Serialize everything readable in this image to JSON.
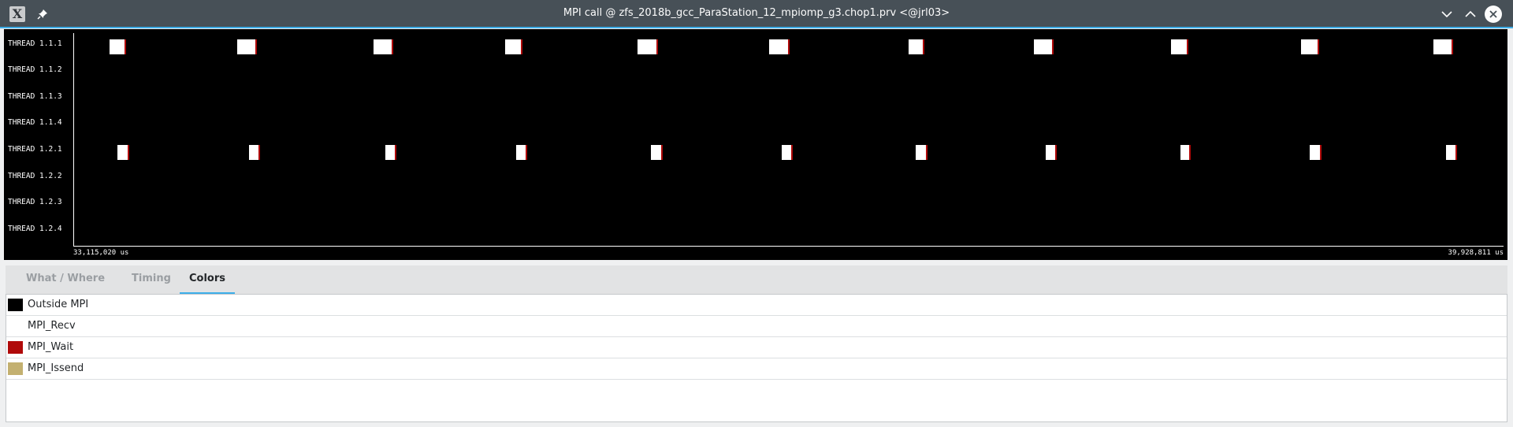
{
  "window": {
    "title": "MPI call @ zfs_2018b_gcc_ParaStation_12_mpiomp_g3.chop1.prv <@jrl03>",
    "app_icon": "X",
    "icons": {
      "app": "x-app-icon",
      "pin": "pin-icon",
      "minimize": "chevron-down-icon",
      "maximize": "chevron-up-icon",
      "close": "close-icon"
    }
  },
  "timeline": {
    "threads": [
      "THREAD 1.1.1",
      "THREAD 1.1.2",
      "THREAD 1.1.3",
      "THREAD 1.1.4",
      "THREAD 1.2.1",
      "THREAD 1.2.2",
      "THREAD 1.2.3",
      "THREAD 1.2.4"
    ],
    "start_label": "33,115,020 us",
    "end_label": "39,928,811 us",
    "colors": {
      "background": "#000000",
      "event": "#ffffff",
      "event_edge": "#b00a0a"
    }
  },
  "tabs": [
    {
      "label": "What / Where",
      "active": false
    },
    {
      "label": "Timing",
      "active": false
    },
    {
      "label": "Colors",
      "active": true
    }
  ],
  "legend": [
    {
      "label": "Outside MPI",
      "color": "#000000"
    },
    {
      "label": "MPI_Recv",
      "color": "#ffffff"
    },
    {
      "label": "MPI_Wait",
      "color": "#b00a0a"
    },
    {
      "label": "MPI_Issend",
      "color": "#c3b070"
    }
  ]
}
